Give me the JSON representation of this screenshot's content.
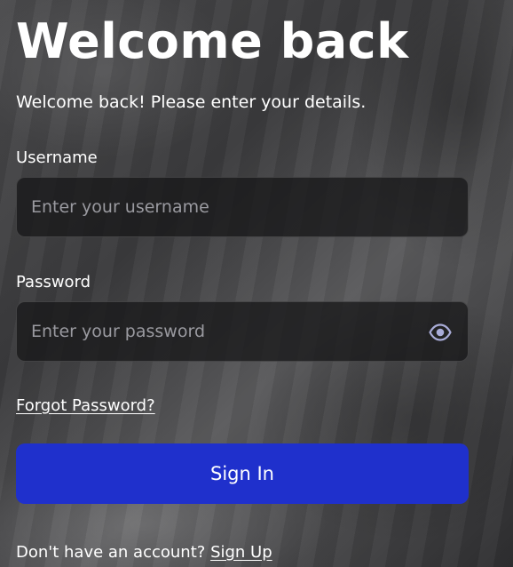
{
  "header": {
    "title": "Welcome back",
    "subtitle": "Welcome back! Please enter your details."
  },
  "form": {
    "username": {
      "label": "Username",
      "placeholder": "Enter your username",
      "value": ""
    },
    "password": {
      "label": "Password",
      "placeholder": "Enter your password",
      "value": "",
      "toggle_icon": "eye-icon"
    },
    "forgot_label": "Forgot Password?",
    "submit_label": "Sign In"
  },
  "footer": {
    "prompt": "Don't have an account?",
    "signup_label": "Sign Up"
  },
  "colors": {
    "accent": "#1f30cc",
    "input_background": "#18181a",
    "placeholder": "#9a9aa0",
    "text": "#ffffff"
  }
}
